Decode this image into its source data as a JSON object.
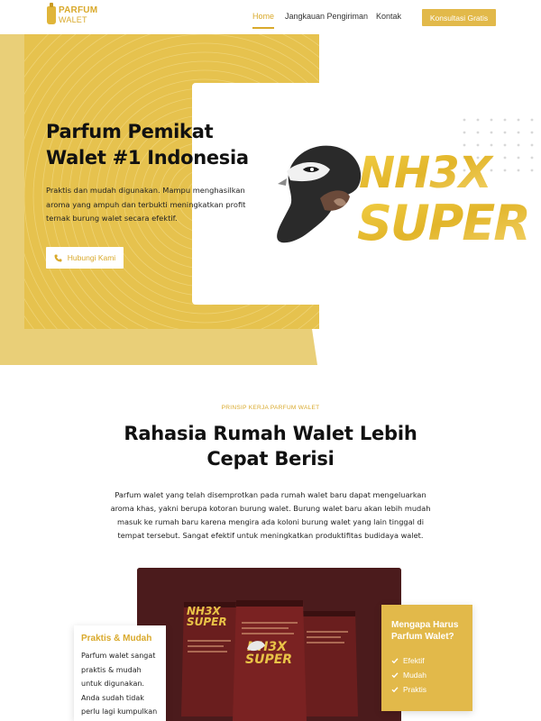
{
  "nav": {
    "logo": {
      "line1": "PARFUM",
      "line2": "WALET"
    },
    "links": [
      "Home",
      "Jangkauan Pengiriman",
      "Kontak"
    ],
    "cta": "Konsultasi Gratis"
  },
  "hero": {
    "title": "Parfum Pemikat Walet #1 Indonesia",
    "subtitle": "Praktis dan mudah digunakan. Mampu menghasilkan aroma yang ampuh dan terbukti meningkatkan profit ternak burung walet secara efektif.",
    "button": "Hubungi Kami",
    "brand_line1": "NH3X",
    "brand_line2": "SUPER"
  },
  "section": {
    "kicker": "PRINSIP KERJA PARFUM WALET",
    "title": "Rahasia Rumah Walet Lebih Cepat Berisi",
    "description": "Parfum walet yang telah disemprotkan pada rumah walet baru dapat mengeluarkan aroma khas, yakni berupa kotoran burung walet. Burung walet baru akan lebih mudah masuk ke rumah baru karena mengira ada koloni burung walet yang lain tinggal di tempat tersebut. Sangat efektif untuk meningkatkan produktifitas budidaya walet."
  },
  "card_left": {
    "title": "Praktis & Mudah",
    "body": "Parfum walet sangat praktis & mudah untuk digunakan. Anda sudah tidak perlu lagi kumpulkan kotoran burung walet"
  },
  "card_right": {
    "title": "Mengapa Harus Parfum Walet?",
    "items": [
      "Efektif",
      "Mudah",
      "Praktis"
    ]
  },
  "colors": {
    "accent": "#e2b94a",
    "hero_yellow": "#e6c24e",
    "product_bg": "#4a1c1c"
  }
}
